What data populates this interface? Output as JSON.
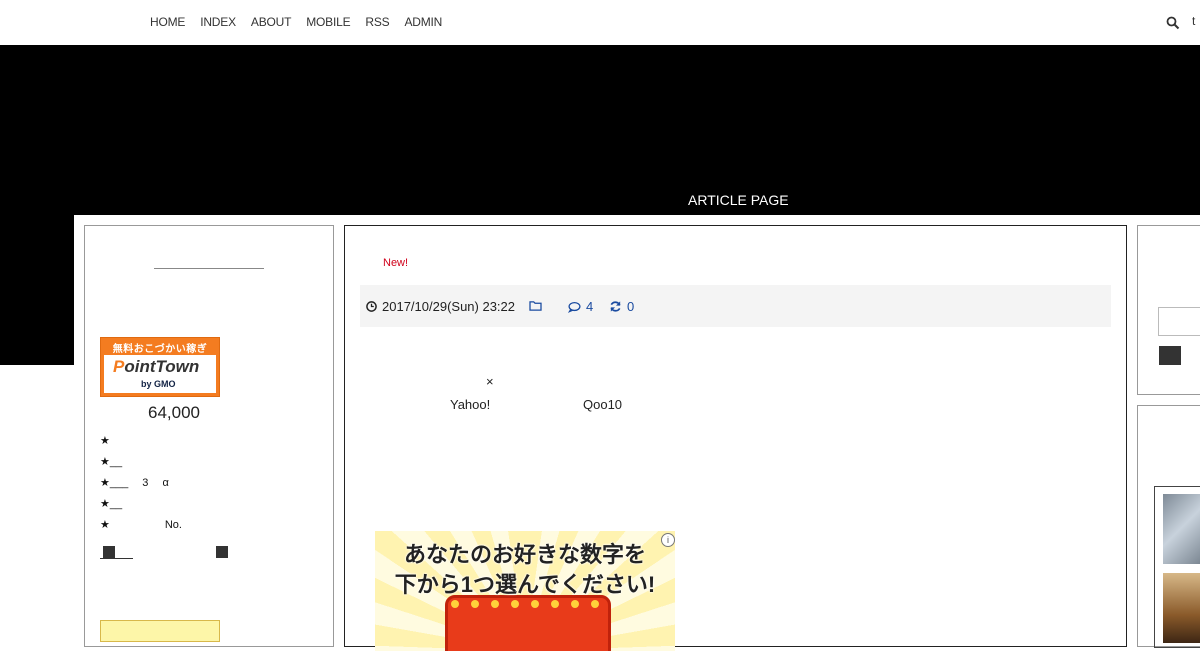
{
  "nav": {
    "items": [
      "HOME",
      "INDEX",
      "ABOUT",
      "MOBILE",
      "RSS",
      "ADMIN"
    ],
    "search_icon": "search-icon",
    "extra_label": "t"
  },
  "hero": {
    "title": "ARTICLE PAGE"
  },
  "sidebar_left": {
    "banner_top": "無料おこづかい稼ぎ",
    "banner_logo_o": "P",
    "banner_logo_rest": "ointTown",
    "banner_gmo": "by GMO",
    "amount": "64,000",
    "star_lines": [
      "★",
      "★__",
      "★___ 　3　 α",
      "★__",
      "★　　　　　No."
    ]
  },
  "article": {
    "new_badge": "New!",
    "date": "2017/10/29(Sun) 23:22",
    "comments": "4",
    "trackbacks": "0",
    "cross": "×",
    "yahoo": "Yahoo!",
    "qoo10": "Qoo10",
    "ad_line1": "あなたのお好きな数字を",
    "ad_line2": "下から1つ選んでください!",
    "ad_info": "i"
  },
  "colors": {
    "accent_blue": "#1a4ba0",
    "new_red": "#d0021b",
    "pointtown_orange": "#f47c20"
  },
  "icons": {
    "clock": "clock-icon",
    "folder": "folder-icon",
    "comment": "comment-icon",
    "refresh": "refresh-icon"
  }
}
